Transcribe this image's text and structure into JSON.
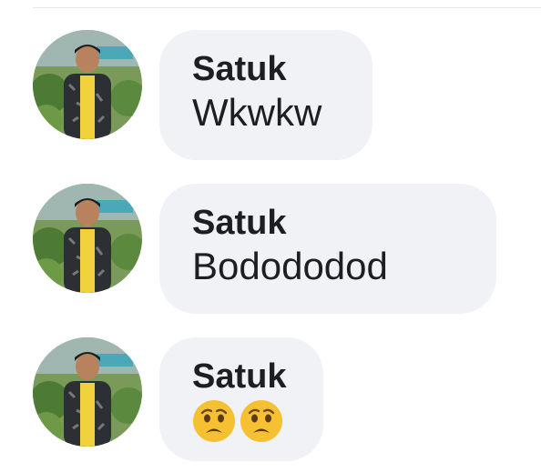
{
  "comments": [
    {
      "author": "Satuk",
      "text": "Wkwkw",
      "emojis": []
    },
    {
      "author": "Satuk",
      "text": "Bodododod",
      "emojis": []
    },
    {
      "author": "Satuk",
      "text": "",
      "emojis": [
        "anxious-face-icon",
        "anxious-face-icon"
      ]
    }
  ],
  "colors": {
    "bubble": "#f0f2f5",
    "text": "#1c1e21",
    "divider": "#e4e6eb"
  }
}
